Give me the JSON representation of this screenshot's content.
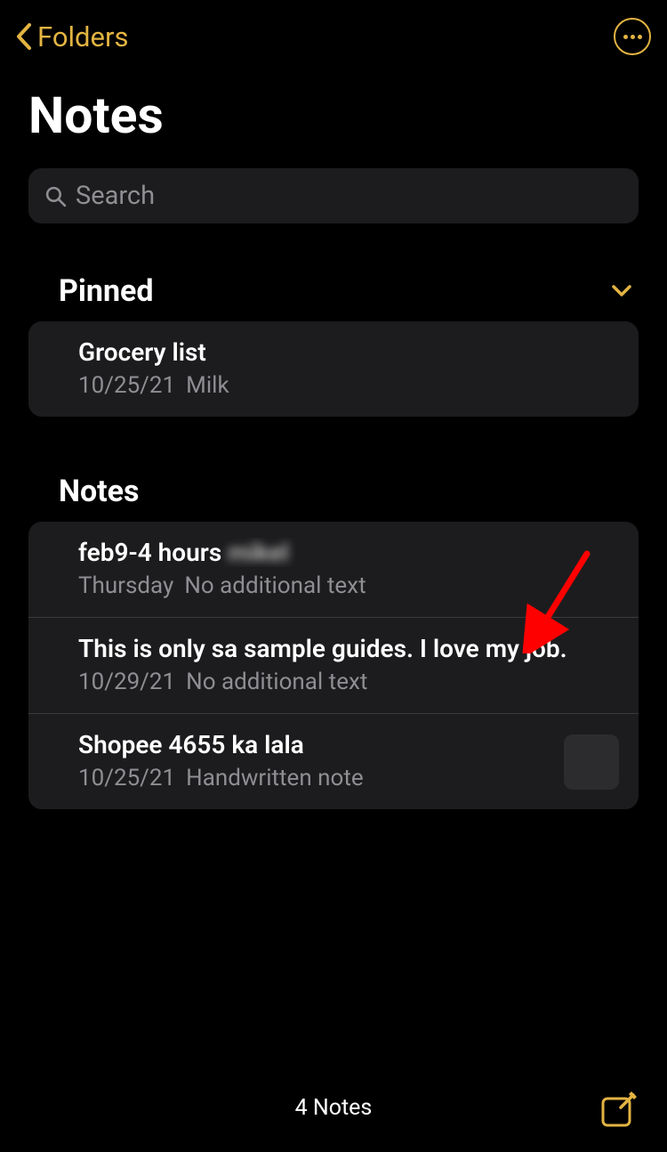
{
  "nav": {
    "back_label": "Folders"
  },
  "page": {
    "title": "Notes"
  },
  "search": {
    "placeholder": "Search"
  },
  "sections": {
    "pinned": {
      "title": "Pinned",
      "items": [
        {
          "title": "Grocery list",
          "date": "10/25/21",
          "preview": "Milk",
          "has_thumb": false
        }
      ]
    },
    "notes": {
      "title": "Notes",
      "items": [
        {
          "title": "feb9-4 hours ",
          "title_blurred": "mikel",
          "date": "Thursday",
          "preview": "No additional text",
          "has_thumb": false
        },
        {
          "title": "This is only sa sample guides. I love my job.",
          "date": "10/29/21",
          "preview": "No additional text",
          "has_thumb": false
        },
        {
          "title": "Shopee 4655 ka lala",
          "date": "10/25/21",
          "preview": "Handwritten note",
          "has_thumb": true
        }
      ]
    }
  },
  "footer": {
    "count_label": "4 Notes"
  },
  "colors": {
    "accent": "#e3b442",
    "bg": "#000000",
    "card": "#1c1c1e",
    "secondary_text": "#8e8e93",
    "annotation": "#ff0000"
  }
}
